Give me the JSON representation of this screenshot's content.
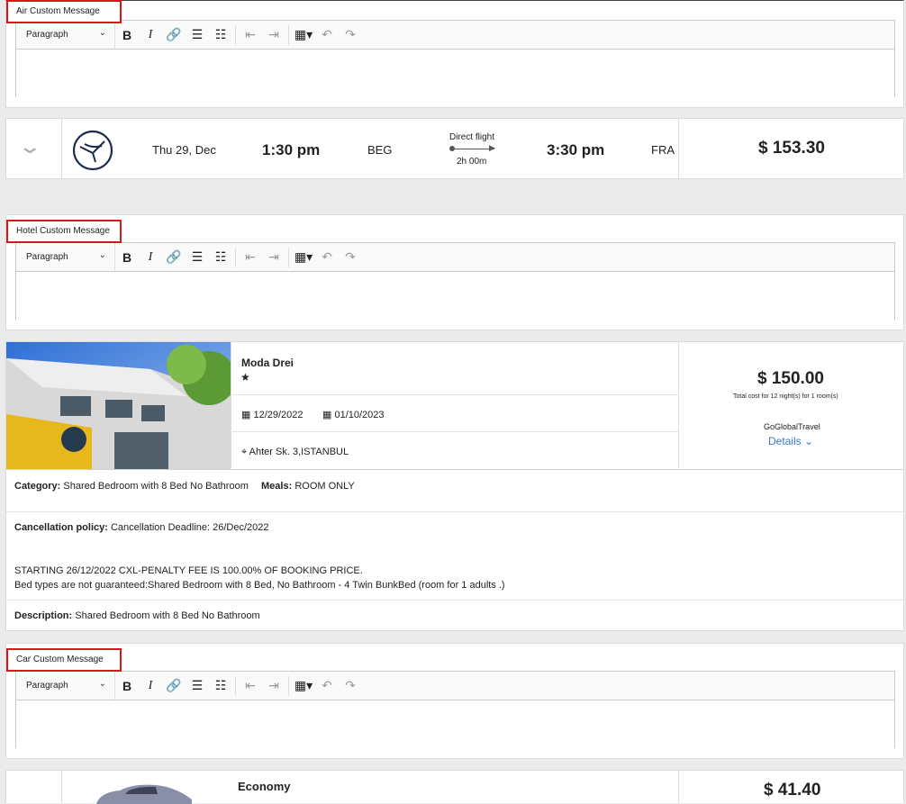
{
  "editor": {
    "format_label": "Paragraph"
  },
  "air": {
    "custom_message_label": "Air Custom Message",
    "date": "Thu 29, Dec",
    "depart_time": "1:30 pm",
    "depart_airport": "BEG",
    "flight_type": "Direct flight",
    "duration": "2h 00m",
    "arrive_time": "3:30 pm",
    "arrive_airport": "FRA",
    "price": "$ 153.30"
  },
  "hotel": {
    "custom_message_label": "Hotel Custom Message",
    "name": "Moda Drei",
    "stars": "★",
    "checkin": "12/29/2022",
    "checkout": "01/10/2023",
    "address": "Ahter Sk. 3,ISTANBUL",
    "price": "$ 150.00",
    "price_note": "Total cost for 12 night(s) for 1 room(s)",
    "provider": "GoGlobalTravel",
    "details_link": "Details",
    "category_label": "Category:",
    "category_value": "Shared Bedroom with 8 Bed No Bathroom",
    "meals_label": "Meals:",
    "meals_value": "ROOM ONLY",
    "cancellation_label": "Cancellation policy:",
    "cancellation_value": "Cancellation Deadline: 26/Dec/2022",
    "policy_line1": "STARTING 26/12/2022 CXL-PENALTY FEE IS 100.00% OF BOOKING PRICE.",
    "policy_line2": "Bed types are not guaranteed:Shared Bedroom with 8 Bed, No Bathroom - 4 Twin BunkBed (room for 1 adults .)",
    "description_label": "Description:",
    "description_value": "Shared Bedroom with 8 Bed No Bathroom"
  },
  "car": {
    "custom_message_label": "Car Custom Message",
    "category": "Economy",
    "price": "$ 41.40"
  },
  "colors": {
    "highlight": "#d9161c",
    "link": "#3b7bbf",
    "airline": "#1b2a4a"
  }
}
